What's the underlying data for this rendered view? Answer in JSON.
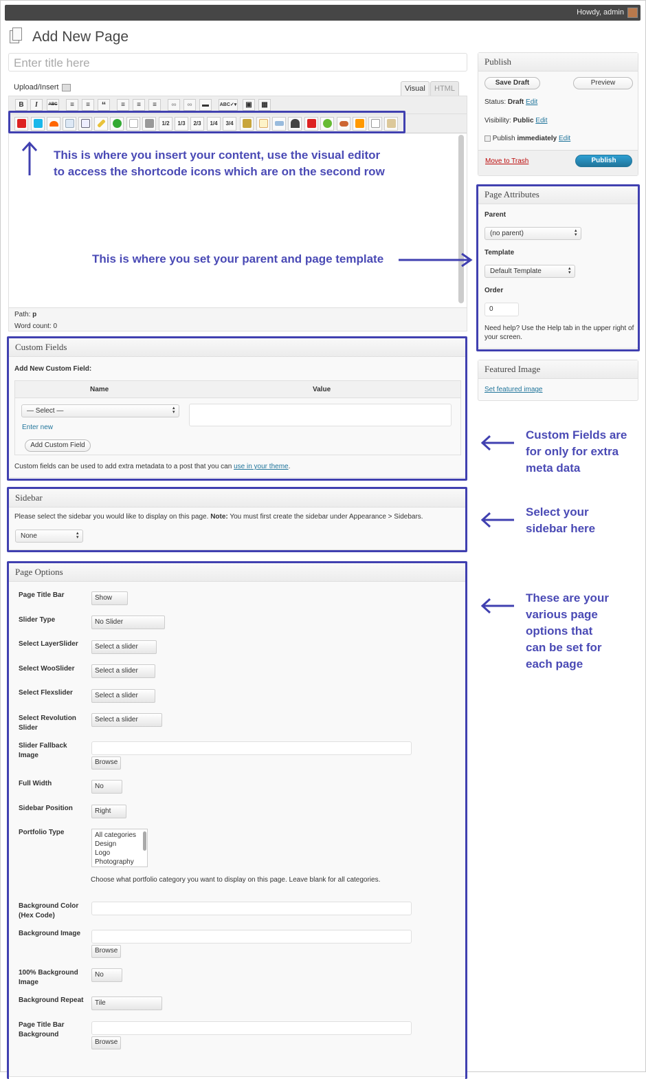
{
  "admin_bar": {
    "howdy": "Howdy, admin"
  },
  "page": {
    "title": "Add New Page",
    "title_placeholder": "Enter title here"
  },
  "editor": {
    "upload_insert": "Upload/Insert",
    "tab_visual": "Visual",
    "tab_html": "HTML",
    "path_label": "Path:",
    "path_value": "p",
    "word_count": "Word count: 0",
    "toolbar1": [
      "B",
      "I",
      "ABC",
      "ul",
      "ol",
      "“",
      "al",
      "ac",
      "ar",
      "lk",
      "ul2",
      "more",
      "ABC",
      "fs",
      "kb"
    ],
    "toolbar2_fractions": [
      "1/2",
      "1/3",
      "2/3",
      "1/4",
      "3/4"
    ]
  },
  "publish": {
    "heading": "Publish",
    "save_draft": "Save Draft",
    "preview": "Preview",
    "status_label": "Status:",
    "status_value": "Draft",
    "visibility_label": "Visibility:",
    "visibility_value": "Public",
    "publish_label": "Publish",
    "publish_value": "immediately",
    "edit": "Edit",
    "move_to_trash": "Move to Trash",
    "publish_button": "Publish"
  },
  "page_attributes": {
    "heading": "Page Attributes",
    "parent_label": "Parent",
    "parent_value": "(no parent)",
    "template_label": "Template",
    "template_value": "Default Template",
    "order_label": "Order",
    "order_value": "0",
    "help_text": "Need help? Use the Help tab in the upper right of your screen."
  },
  "featured_image": {
    "heading": "Featured Image",
    "link": "Set featured image"
  },
  "custom_fields": {
    "heading": "Custom Fields",
    "add_new": "Add New Custom Field:",
    "col_name": "Name",
    "col_value": "Value",
    "select": "— Select —",
    "enter_new": "Enter new",
    "add_button": "Add Custom Field",
    "note": "Custom fields can be used to add extra metadata to a post that you can",
    "note_link": "use in your theme",
    "note_end": "."
  },
  "sidebar_box": {
    "heading": "Sidebar",
    "desc": "Please select the sidebar you would like to display on this page.",
    "note_bold": "Note:",
    "note_text": "You must first create the sidebar under Appearance > Sidebars.",
    "value": "None"
  },
  "page_options": {
    "heading": "Page Options",
    "page_title_bar": {
      "label": "Page Title Bar",
      "value": "Show"
    },
    "slider_type": {
      "label": "Slider Type",
      "value": "No Slider"
    },
    "layerslider": {
      "label": "Select LayerSlider",
      "value": "Select a slider"
    },
    "wooslider": {
      "label": "Select WooSlider",
      "value": "Select a slider"
    },
    "flexslider": {
      "label": "Select Flexslider",
      "value": "Select a slider"
    },
    "revolution_1": "Select Revolution",
    "revolution_2": "Slider",
    "revolution_value": "Select a slider",
    "fallback_1": "Slider Fallback",
    "fallback_2": "Image",
    "browse": "Browse",
    "full_width": {
      "label": "Full Width",
      "value": "No"
    },
    "sidebar_position": {
      "label": "Sidebar Position",
      "value": "Right"
    },
    "portfolio_type": {
      "label": "Portfolio Type",
      "options": [
        "All categories",
        "Design",
        "Logo",
        "Photography"
      ],
      "note": "Choose what portfolio category you want to display on this page. Leave blank for all categories."
    },
    "bg_color_1": "Background Color",
    "bg_color_2": "(Hex Code)",
    "bg_image": "Background Image",
    "bg_full_1": "100% Background",
    "bg_full_2": "Image",
    "bg_full_value": "No",
    "bg_repeat": {
      "label": "Background Repeat",
      "value": "Tile"
    },
    "title_bg_1": "Page Title Bar",
    "title_bg_2": "Background"
  },
  "annotations": {
    "content_1": "This is where you insert your content, use the visual editor",
    "content_2": "to access the shortcode icons which are on the second row",
    "parent": "This is where you set your parent and page template",
    "custom_1": "Custom Fields are",
    "custom_2": "for only for extra",
    "custom_3": "meta data",
    "sidebar_1": "Select your",
    "sidebar_2": "sidebar here",
    "options_1": "These are your",
    "options_2": "various page",
    "options_3": "options that",
    "options_4": "can be set for",
    "options_5": "each page"
  },
  "colors": {
    "annotation": "#4040b0",
    "admin_bar": "#464646",
    "link": "#21759b",
    "publish": "#21759b",
    "trash": "#bc0b0b"
  }
}
